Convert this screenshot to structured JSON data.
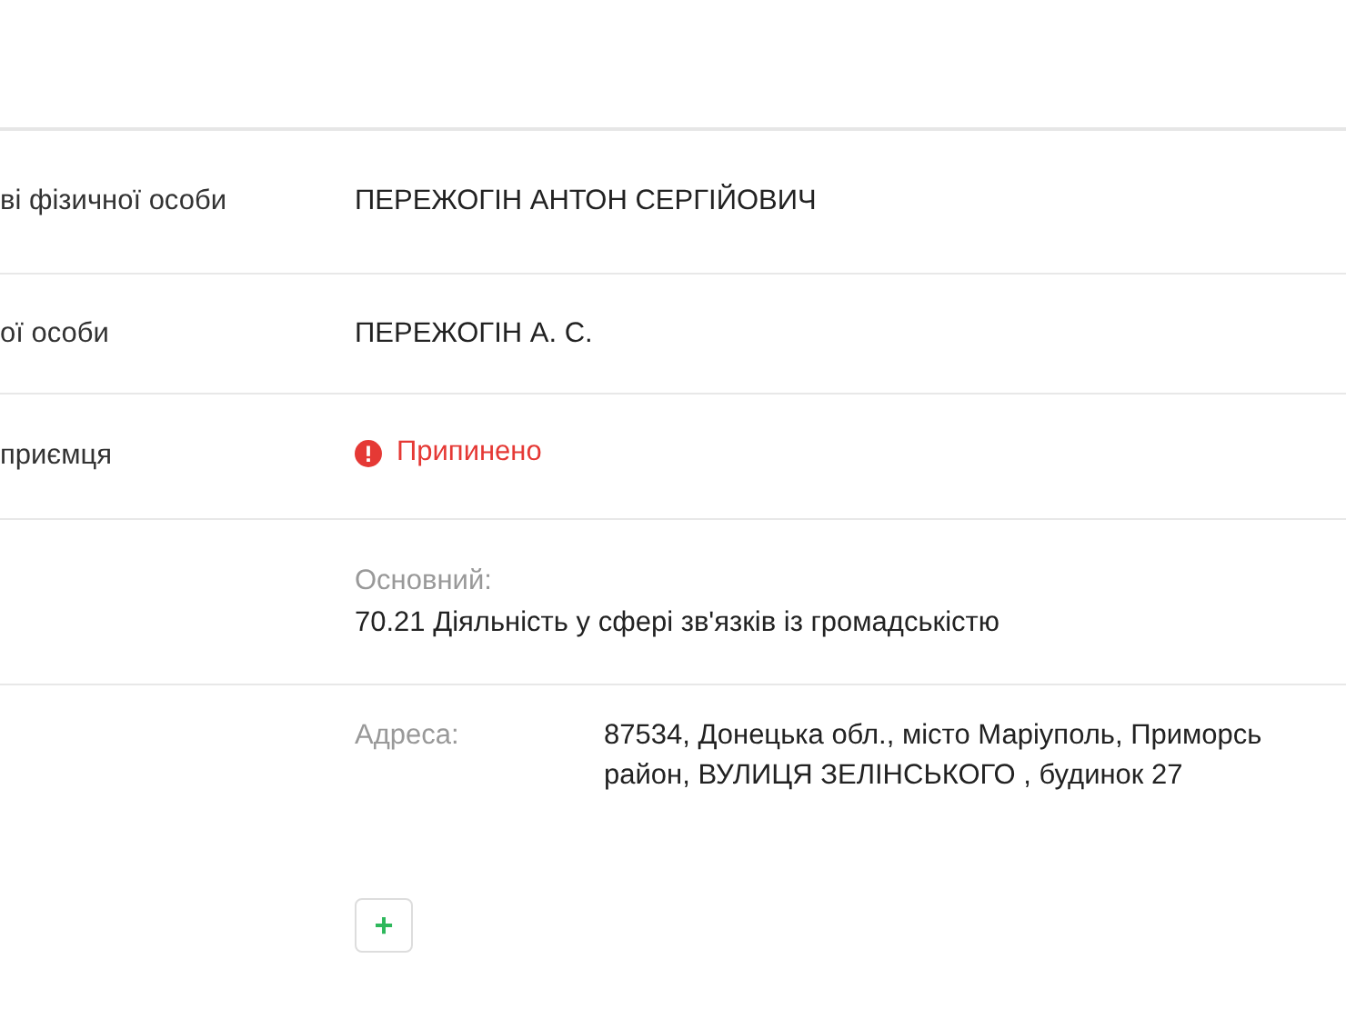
{
  "rows": [
    {
      "label": "ві фізичної особи",
      "value": "ПЕРЕЖОГІН АНТОН СЕРГІЙОВИЧ"
    },
    {
      "label": "ої особи",
      "value": "ПЕРЕЖОГІН А. С."
    },
    {
      "label": "приємця",
      "status": {
        "text": "Припинено",
        "kind": "terminated"
      }
    },
    {
      "activity": {
        "caption": "Основний:",
        "text": "70.21 Діяльність у сфері зв'язків із громадськістю"
      }
    },
    {
      "address": {
        "caption": "Адреса:",
        "lines": [
          "87534, Донецька обл., місто Маріуполь, Приморсь",
          "район, ВУЛИЦЯ ЗЕЛІНСЬКОГО , будинок 27"
        ]
      }
    }
  ],
  "add_button": {
    "label": "+"
  }
}
